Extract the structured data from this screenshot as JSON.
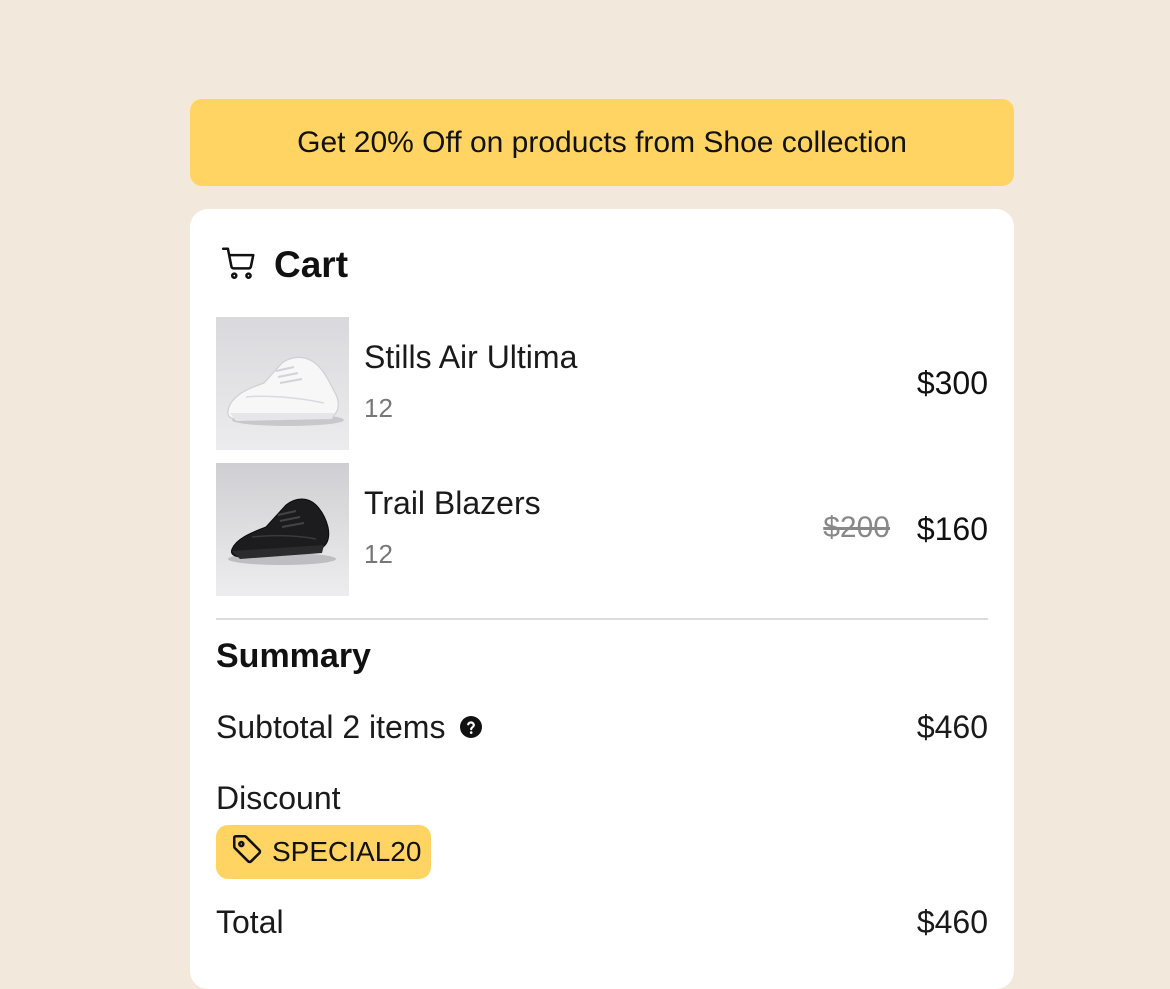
{
  "banner": {
    "text": "Get 20% Off on products from Shoe collection"
  },
  "cart": {
    "title": "Cart",
    "icon": "cart-icon",
    "items": [
      {
        "name": "Stills Air Ultima",
        "size": "12",
        "price": "$300",
        "original_price": null,
        "image": "white-sneaker"
      },
      {
        "name": "Trail Blazers",
        "size": "12",
        "price": "$160",
        "original_price": "$200",
        "image": "black-sneaker"
      }
    ]
  },
  "summary": {
    "title": "Summary",
    "subtotal_label": "Subtotal 2 items",
    "subtotal_value": "$460",
    "discount_label": "Discount",
    "coupon_code": "SPECIAL20",
    "total_label": "Total",
    "total_value": "$460"
  },
  "colors": {
    "background": "#f3e8dc",
    "accent": "#ffd463",
    "card": "#ffffff"
  }
}
